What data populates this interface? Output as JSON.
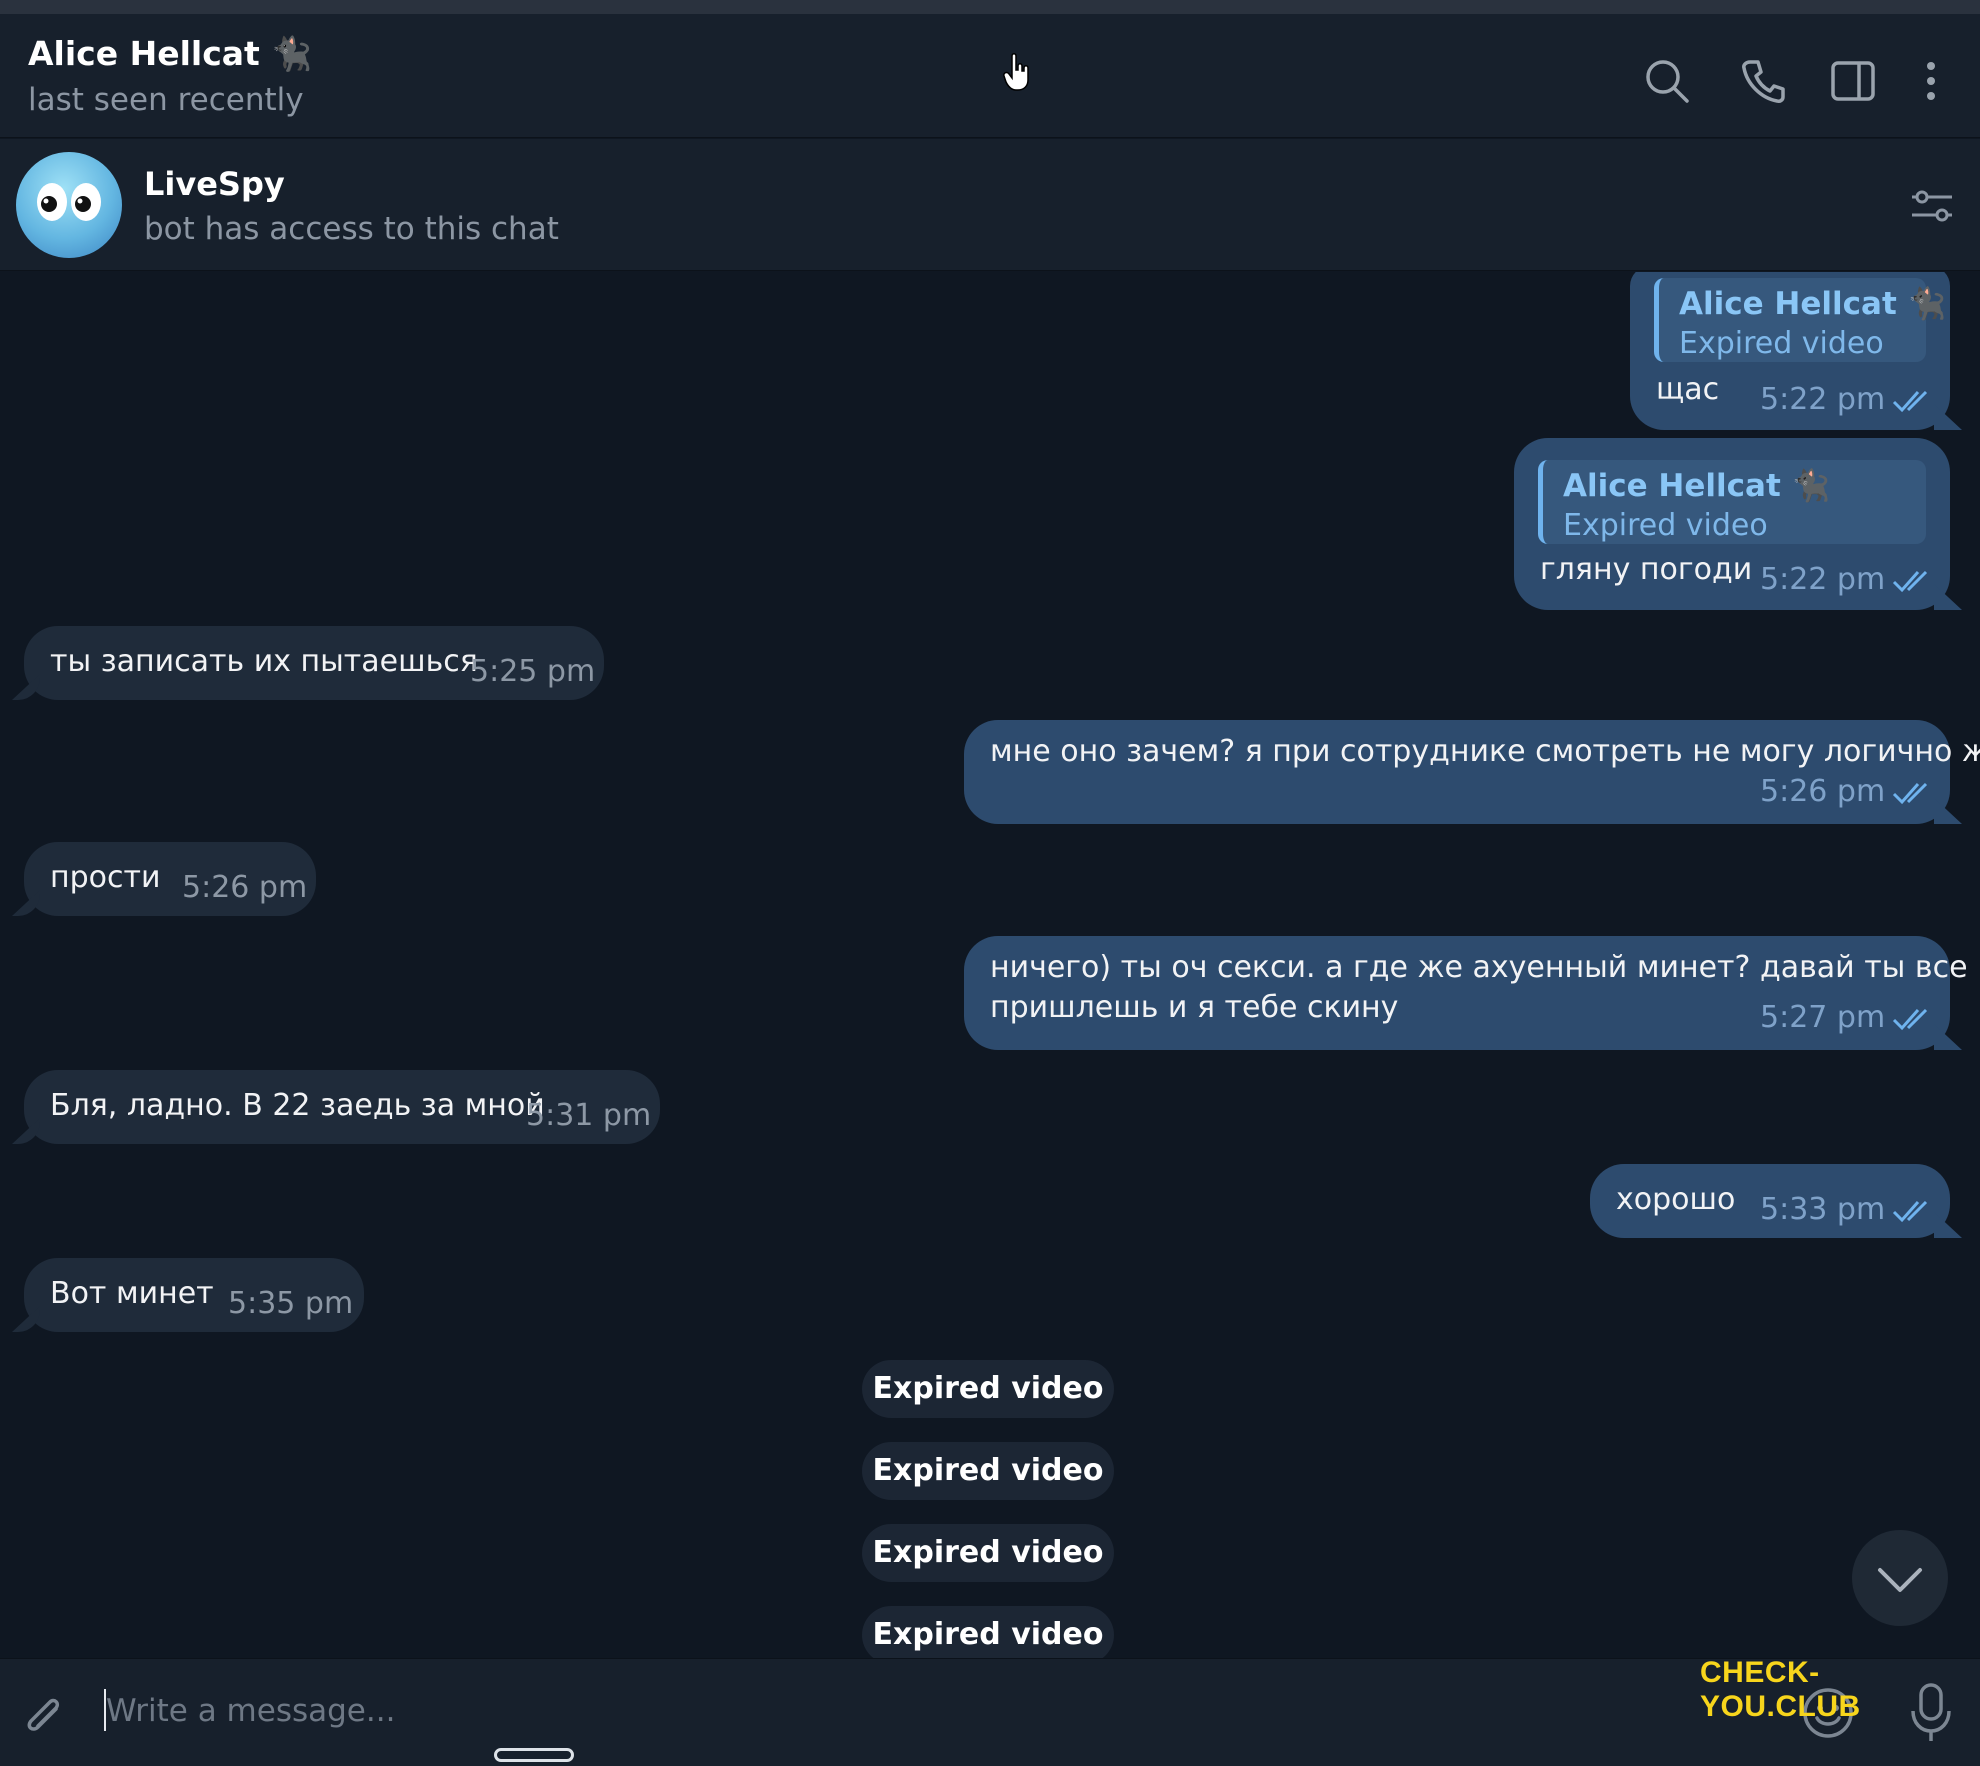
{
  "header": {
    "title": "Alice Hellcat 🐈‍⬛",
    "status": "last seen recently",
    "icons": [
      "search-icon",
      "phone-icon",
      "sidebar-icon",
      "more-icon"
    ]
  },
  "bot_bar": {
    "name": "LiveSpy",
    "subtitle": "bot has access to this chat"
  },
  "messages": [
    {
      "dir": "out",
      "reply_name": "Alice Hellcat 🐈‍⬛",
      "reply_text": "Expired video",
      "text": "щас",
      "time": "5:22 pm"
    },
    {
      "dir": "out",
      "reply_name": "Alice Hellcat 🐈‍⬛",
      "reply_text": "Expired video",
      "text": "гляну погоди",
      "time": "5:22 pm"
    },
    {
      "dir": "in",
      "text": "ты записать их пытаешься",
      "time": "5:25 pm"
    },
    {
      "dir": "out",
      "text": "мне оно зачем? я при сотруднике смотреть не могу логично же",
      "time": "5:26 pm"
    },
    {
      "dir": "in",
      "text": "прости",
      "time": "5:26 pm"
    },
    {
      "dir": "out",
      "text_line1": "ничего) ты оч секси. а где же ахуенный минет? давай ты все",
      "text_line2": "пришлешь и я тебе скину",
      "time": "5:27 pm"
    },
    {
      "dir": "in",
      "text": "Бля, ладно. В 22 заедь за мной",
      "time": "5:31 pm"
    },
    {
      "dir": "out",
      "text": "хорошо",
      "time": "5:33 pm"
    },
    {
      "dir": "in",
      "text": "Вот минет",
      "time": "5:35 pm"
    }
  ],
  "service_messages": [
    "Expired video",
    "Expired video",
    "Expired video",
    "Expired video"
  ],
  "composer": {
    "placeholder": "Write a message..."
  },
  "watermark": "CHECK-YOU.CLUB",
  "colors": {
    "background": "#0f1722",
    "header": "#17202c",
    "incoming_bubble": "#1f2b3a",
    "outgoing_bubble": "#2d4b6e",
    "accent": "#6fb3ee",
    "watermark": "#f7d51c"
  }
}
